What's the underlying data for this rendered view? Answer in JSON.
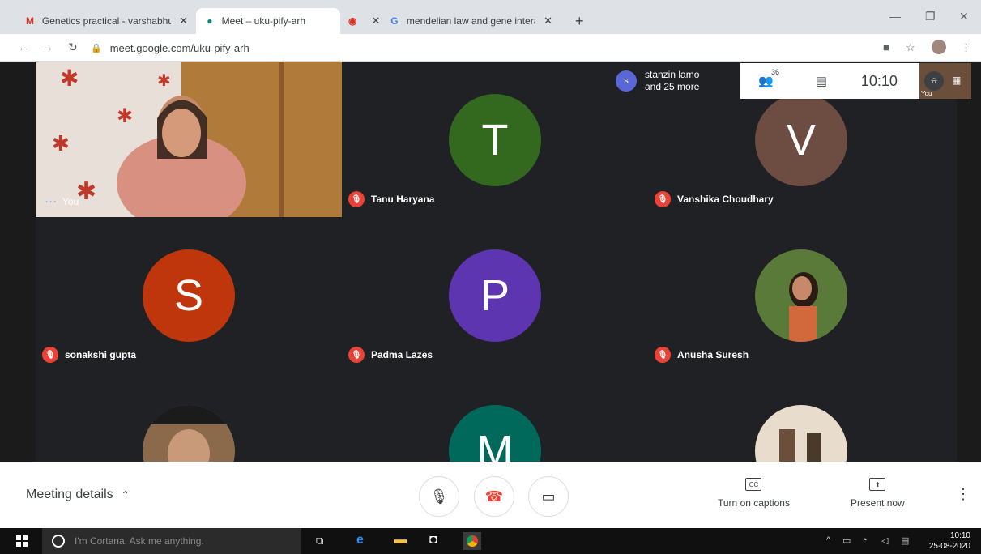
{
  "browser": {
    "tabs": [
      {
        "title": "Genetics practical - varshabhu@",
        "favicon": "gmail-icon"
      },
      {
        "title": "Meet – uku-pify-arh",
        "favicon": "meet-icon"
      },
      {
        "title": "",
        "favicon": "recording-icon"
      },
      {
        "title": "mendelian law and gene interact",
        "favicon": "google-icon"
      }
    ],
    "new_tab": "+",
    "url": "meet.google.com/uku-pify-arh"
  },
  "meet": {
    "self_label": "You",
    "presenter_info": {
      "initial": "s",
      "line1": "stanzin lamo",
      "line2": "and 25 more"
    },
    "participant_count": "36",
    "clock": "10:10",
    "self_mini_label": "You",
    "tiles": [
      {
        "name": "Tanu Haryana",
        "initial": "T",
        "color": "#33691e"
      },
      {
        "name": "Vanshika Choudhary",
        "initial": "V",
        "color": "#6d4c41"
      },
      {
        "name": "sonakshi gupta",
        "initial": "S",
        "color": "#bf360c"
      },
      {
        "name": "Padma Lazes",
        "initial": "P",
        "color": "#5e35b1"
      },
      {
        "name": "Anusha Suresh",
        "initial": "",
        "color": "#4a5a2a"
      },
      {
        "name": "",
        "initial": "",
        "color": "#8a6a4a"
      },
      {
        "name": "",
        "initial": "M",
        "color": "#00695c"
      },
      {
        "name": "",
        "initial": "",
        "color": "#b9a58a"
      }
    ],
    "bottom": {
      "meeting_details": "Meeting details",
      "captions": "Turn on captions",
      "captions_icon_text": "CC",
      "present": "Present now"
    }
  },
  "taskbar": {
    "cortana_placeholder": "I'm Cortana. Ask me anything.",
    "time": "10:10",
    "date": "25-08-2020"
  }
}
